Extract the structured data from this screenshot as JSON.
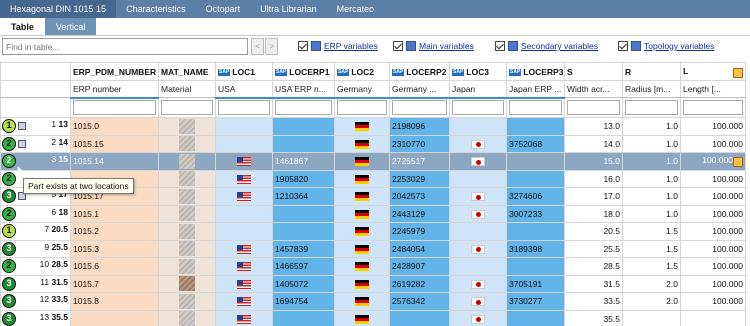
{
  "top_tabs": [
    "Hexagonal DIN 1015 15",
    "Characteristics",
    "Octopart",
    "Ultra Librarian",
    "Mercateo"
  ],
  "sub_tabs": [
    "Table",
    "Vertical"
  ],
  "find_placeholder": "Find in table...",
  "nav": {
    "prev": "<",
    "next": ">"
  },
  "view_options": [
    "ERP variables",
    "Main variables",
    "Secondary variables",
    "Topology variables"
  ],
  "columns": [
    {
      "name": "ERP_PDM_NUMBER",
      "sub": "ERP number"
    },
    {
      "name": "MAT_NAME",
      "sub": "Material"
    },
    {
      "name": "LOC1",
      "sub": "USA"
    },
    {
      "name": "LOCERP1",
      "sub": "USA ERP n..."
    },
    {
      "name": "LOC2",
      "sub": "Germany"
    },
    {
      "name": "LOCERP2",
      "sub": "Germany ..."
    },
    {
      "name": "LOC3",
      "sub": "Japan"
    },
    {
      "name": "LOCERP3",
      "sub": "Japan ERP ..."
    },
    {
      "name": "S",
      "sub": "Width acr..."
    },
    {
      "name": "R",
      "sub": "Radius [m..."
    },
    {
      "name": "L",
      "sub": "Length [..."
    }
  ],
  "rows": [
    {
      "status": "1",
      "box": true,
      "n": "1",
      "id": "13",
      "erp": "1015.0",
      "us": false,
      "usn": "",
      "de": true,
      "den": "2198096",
      "jp": false,
      "jpn": "",
      "s": "13.0",
      "r": "1.0",
      "l": "100.000"
    },
    {
      "status": "2",
      "box": true,
      "n": "2",
      "id": "14",
      "erp": "1015.15",
      "us": false,
      "usn": "",
      "de": true,
      "den": "2310770",
      "jp": true,
      "jpn": "3752068",
      "s": "14.0",
      "r": "1.0",
      "l": "100.000"
    },
    {
      "status": "2",
      "box": false,
      "n": "3",
      "id": "15",
      "erp": "1015.14",
      "us": true,
      "usn": "1461867",
      "de": true,
      "den": "2725517",
      "jp": true,
      "jpn": "",
      "s": "15.0",
      "r": "1.0",
      "l": "100.000"
    },
    {
      "status": "2",
      "box": false,
      "n": "",
      "id": "",
      "erp": "",
      "us": true,
      "usn": "1905820",
      "de": true,
      "den": "2253029",
      "jp": false,
      "jpn": "",
      "s": "16.0",
      "r": "1.0",
      "l": "100.000"
    },
    {
      "status": "3",
      "box": true,
      "n": "5",
      "id": "17",
      "erp": "1015.17",
      "us": true,
      "usn": "1210364",
      "de": true,
      "den": "2042573",
      "jp": true,
      "jpn": "3274606",
      "s": "17.0",
      "r": "1.0",
      "l": "100.000"
    },
    {
      "status": "2",
      "box": false,
      "n": "6",
      "id": "18",
      "erp": "1015.1",
      "us": false,
      "usn": "",
      "de": true,
      "den": "2443129",
      "jp": true,
      "jpn": "3007233",
      "s": "18.0",
      "r": "1.0",
      "l": "100.000"
    },
    {
      "status": "1",
      "box": false,
      "n": "7",
      "id": "20.5",
      "erp": "1015.2",
      "us": false,
      "usn": "",
      "de": true,
      "den": "2245979",
      "jp": false,
      "jpn": "",
      "s": "20.5",
      "r": "1.5",
      "l": "100.000"
    },
    {
      "status": "3",
      "box": false,
      "n": "9",
      "id": "25.5",
      "erp": "1015.3",
      "us": true,
      "usn": "1457839",
      "de": true,
      "den": "2484054",
      "jp": true,
      "jpn": "3189398",
      "s": "25.5",
      "r": "1.5",
      "l": "100.000"
    },
    {
      "status": "2",
      "box": false,
      "n": "10",
      "id": "28.5",
      "erp": "1015.6",
      "us": true,
      "usn": "1466597",
      "de": true,
      "den": "2428907",
      "jp": false,
      "jpn": "",
      "s": "28.5",
      "r": "1.5",
      "l": "100.000"
    },
    {
      "status": "3",
      "box": false,
      "n": "11",
      "id": "31.5",
      "erp": "1015.7",
      "us": true,
      "usn": "1405072",
      "de": true,
      "den": "2619282",
      "jp": true,
      "jpn": "3705191",
      "s": "31.5",
      "r": "2.0",
      "l": "100.000"
    },
    {
      "status": "3",
      "box": false,
      "n": "12",
      "id": "33.5",
      "erp": "1015.8",
      "us": true,
      "usn": "1694754",
      "de": true,
      "den": "2576342",
      "jp": true,
      "jpn": "3730277",
      "s": "33.5",
      "r": "2.0",
      "l": "100.000"
    },
    {
      "status": "3",
      "box": false,
      "n": "13",
      "id": "35.5",
      "erp": "",
      "us": true,
      "usn": "",
      "de": true,
      "den": "",
      "jp": true,
      "jpn": "",
      "s": "35.5",
      "r": "",
      "l": ""
    }
  ],
  "tooltip": "Part exists at two locations"
}
